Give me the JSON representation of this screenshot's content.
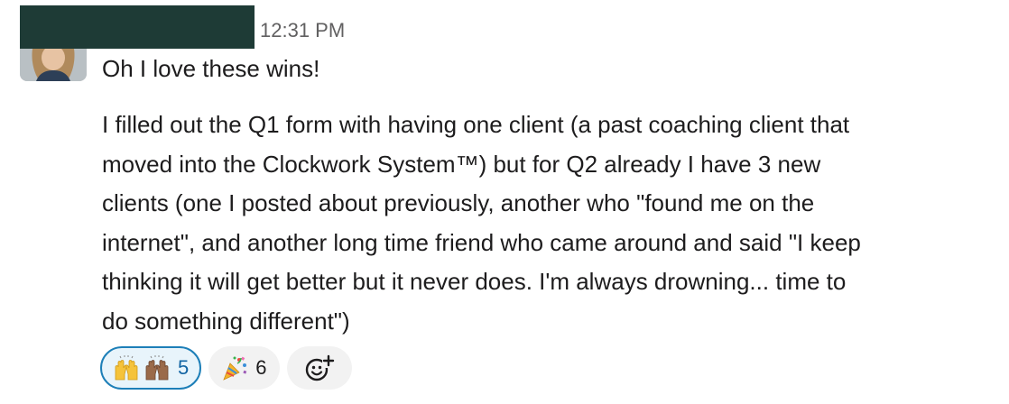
{
  "message": {
    "timestamp": "12:31 PM",
    "first_line": "Oh I love these wins!",
    "body_lines": [
      "I filled out the Q1 form with having one client (a past coaching client that",
      "moved into the Clockwork System™) but for Q2 already I have 3 new",
      "clients (one I posted about previously, another who \"found me on the",
      "internet\", and another long time friend who came around and said \"I keep",
      "thinking it will get better but it never does. I'm always drowning... time to",
      "do something different\")"
    ]
  },
  "reactions": [
    {
      "emoji": [
        "raised-hands-icon",
        "raised-hands-medium-skin-icon"
      ],
      "count": "5",
      "selected": true
    },
    {
      "emoji": [
        "party-popper-icon"
      ],
      "count": "6",
      "selected": false
    }
  ],
  "colors": {
    "redaction": "#1e3b36",
    "reaction_selected_border": "#1d7fb8",
    "reaction_selected_bg": "#e8f4fb",
    "reaction_bg": "#f2f2f2"
  }
}
